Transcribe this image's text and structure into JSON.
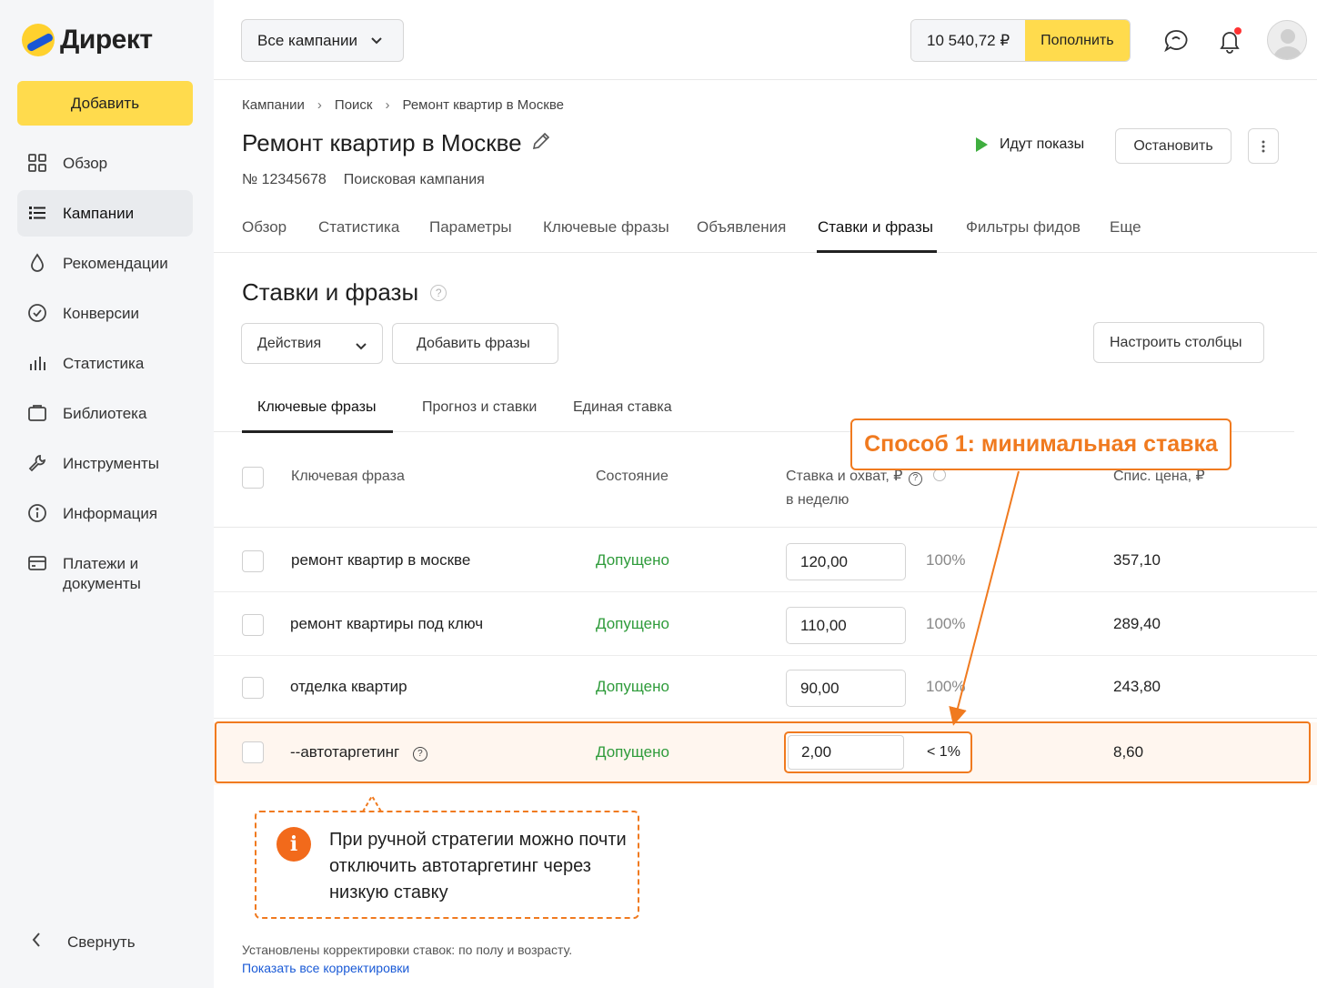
{
  "colors": {
    "accent": "#ffdb4d",
    "highlight": "#f07a1f",
    "success": "#2e9b3a",
    "link": "#1a5ad6"
  },
  "sidebar": {
    "logo": "Директ",
    "add_button": "Добавить",
    "items": [
      {
        "label": "Обзор",
        "icon": "grid-icon"
      },
      {
        "label": "Кампании",
        "icon": "list-icon"
      },
      {
        "label": "Рекомендации",
        "icon": "drop-icon"
      },
      {
        "label": "Конверсии",
        "icon": "target-icon"
      },
      {
        "label": "Статистика",
        "icon": "bar-chart-icon"
      },
      {
        "label": "Библиотека",
        "icon": "folder-icon"
      },
      {
        "label": "Инструменты",
        "icon": "wrench-icon"
      },
      {
        "label": "Информация",
        "icon": "info-icon"
      },
      {
        "label": "Платежи и документы",
        "icon": "card-icon"
      }
    ],
    "collapse_label": "Свернуть"
  },
  "topbar": {
    "campaign_select": "Все кампании",
    "balance": "10 540,72 ₽",
    "topup_button": "Пополнить"
  },
  "page": {
    "breadcrumbs": [
      "Кампании",
      "Поиск",
      "Ремонт квартир в Москве"
    ],
    "title": "Ремонт квартир в Москве",
    "number": "№ 12345678",
    "type": "Поисковая кампания",
    "status": "Идут показы",
    "stop_button": "Остановить",
    "tabs": [
      "Обзор",
      "Статистика",
      "Параметры",
      "Ключевые фразы",
      "Объявления",
      "Ставки и фразы",
      "Фильтры фидов",
      "Еще"
    ],
    "active_tab": "Ставки и фразы"
  },
  "section": {
    "title": "Ставки и фразы",
    "actions_select": "Действия",
    "add_phrases_button": "Добавить фразы",
    "columns_button": "Настроить столбцы",
    "subtabs": [
      "Ключевые фразы",
      "Прогноз и ставки",
      "Единая ставка"
    ]
  },
  "table": {
    "headers": {
      "phrase": "Ключевая фраза",
      "state": "Состояние",
      "bid_line1": "Ставка и охват, ₽",
      "bid_line2": "в неделю",
      "price": "Спис. цена, ₽"
    },
    "rows": [
      {
        "phrase": "ремонт квартир в москве",
        "state": "Допущено",
        "bid": "120,00",
        "reach": "100%",
        "price": "357,10"
      },
      {
        "phrase": "ремонт квартиры под ключ",
        "state": "Допущено",
        "bid": "110,00",
        "reach": "100%",
        "price": "289,40"
      },
      {
        "phrase": "отделка квартир",
        "state": "Допущено",
        "bid": "90,00",
        "reach": "100%",
        "price": "243,80"
      },
      {
        "phrase": "--автотаргетинг",
        "state": "Допущено",
        "bid": "2,00",
        "reach": "< 1%",
        "price": "8,60"
      }
    ]
  },
  "annotation": {
    "callout": "Способ 1: минимальная ставка",
    "note": "При ручной стратегии можно почти отключить автотаргетинг через низкую ставку"
  },
  "footer": {
    "note": "Установлены корректировки ставок: по полу и возрасту.",
    "link": "Показать все корректировки"
  }
}
